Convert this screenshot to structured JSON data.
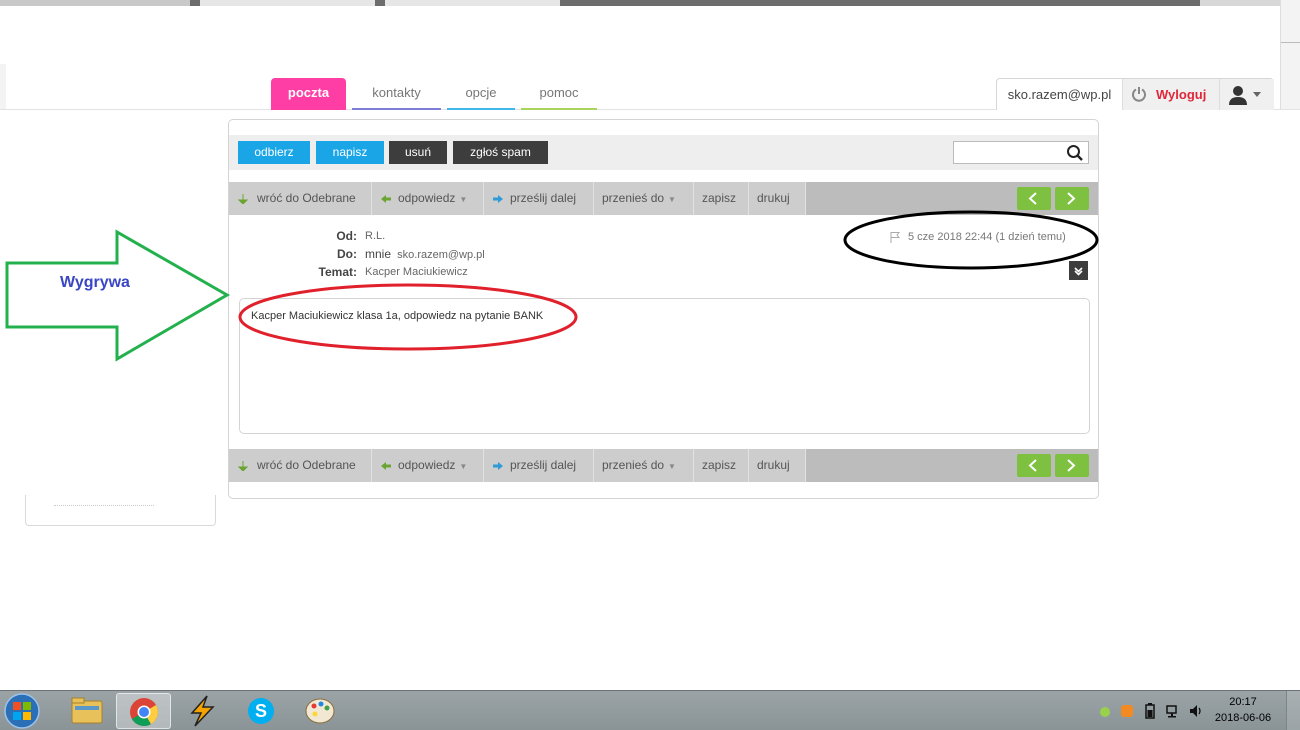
{
  "nav": {
    "tabs": [
      {
        "label": "poczta",
        "color": "#ff3ea5",
        "active": true
      },
      {
        "label": "kontakty",
        "color": "#7d7fd6"
      },
      {
        "label": "opcje",
        "color": "#3fb7e8"
      },
      {
        "label": "pomoc",
        "color": "#a9d35c"
      }
    ]
  },
  "user": {
    "email": "sko.razem@wp.pl",
    "logout_label": "Wyloguj"
  },
  "toolbar": {
    "receive_label": "odbierz",
    "compose_label": "napisz",
    "delete_label": "usuń",
    "spam_label": "zgłoś spam",
    "search_placeholder": ""
  },
  "actions": {
    "back_label": "wróć do Odebrane",
    "reply_label": "odpowiedz",
    "forward_label": "prześlij dalej",
    "move_label": "przenieś do",
    "save_label": "zapisz",
    "print_label": "drukuj"
  },
  "message": {
    "from_label": "Od:",
    "from_value": "R.L.",
    "to_label": "Do:",
    "to_name": "mnie",
    "to_email": "sko.razem@wp.pl",
    "subject_label": "Temat:",
    "subject_value": "Kacper Maciukiewicz",
    "date": "5 cze 2018 22:44 (1 dzień temu)",
    "body": "Kacper Maciukiewicz klasa 1a, odpowiedz na pytanie BANK"
  },
  "annotation": {
    "arrow_label": "Wygrywa",
    "arrow_color": "#22b14c",
    "circle_red": "#e0202a",
    "circle_black": "#000000"
  },
  "taskbar": {
    "time": "20:17",
    "date": "2018-06-06"
  }
}
